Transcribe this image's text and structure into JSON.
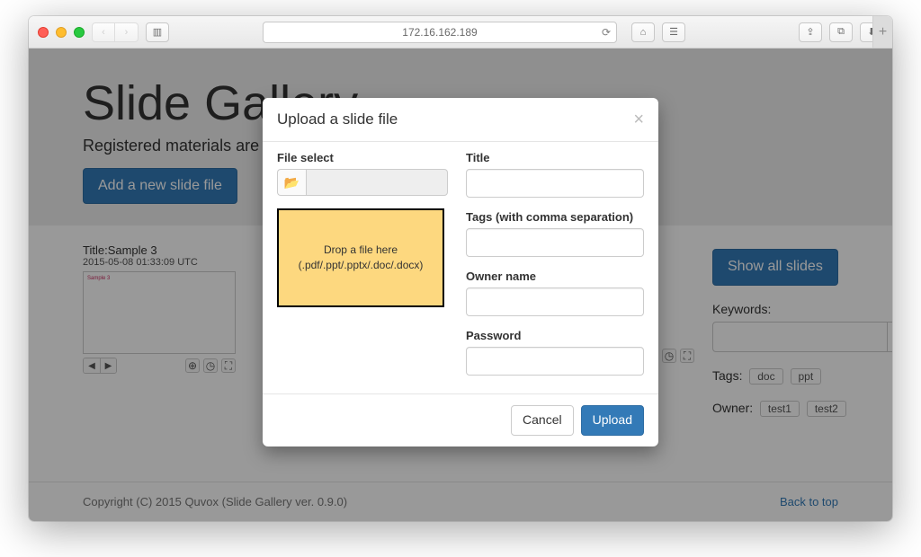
{
  "browser": {
    "url": "172.16.162.189"
  },
  "jumbotron": {
    "title": "Slide Gallery",
    "subtitle": "Registered materials are conve",
    "add_button": "Add a new slide file"
  },
  "slides": [
    {
      "title": "Title:Sample 3",
      "timestamp": "2015-05-08 01:33:09 UTC",
      "preview_label": "Sample 3"
    }
  ],
  "sidebar": {
    "show_all": "Show all slides",
    "keywords_label": "Keywords:",
    "tags_label": "Tags:",
    "tags": [
      "doc",
      "ppt"
    ],
    "owner_label": "Owner:",
    "owners": [
      "test1",
      "test2"
    ]
  },
  "footer": {
    "copyright": "Copyright (C) 2015 Quvox (Slide Gallery ver. 0.9.0)",
    "back_to_top": "Back to top"
  },
  "modal": {
    "title": "Upload a slide file",
    "file_select_label": "File select",
    "drop_line1": "Drop a file here",
    "drop_line2": "(.pdf/.ppt/.pptx/.doc/.docx)",
    "fields": {
      "title": "Title",
      "tags": "Tags (with comma separation)",
      "owner": "Owner name",
      "password": "Password"
    },
    "cancel": "Cancel",
    "upload": "Upload"
  }
}
